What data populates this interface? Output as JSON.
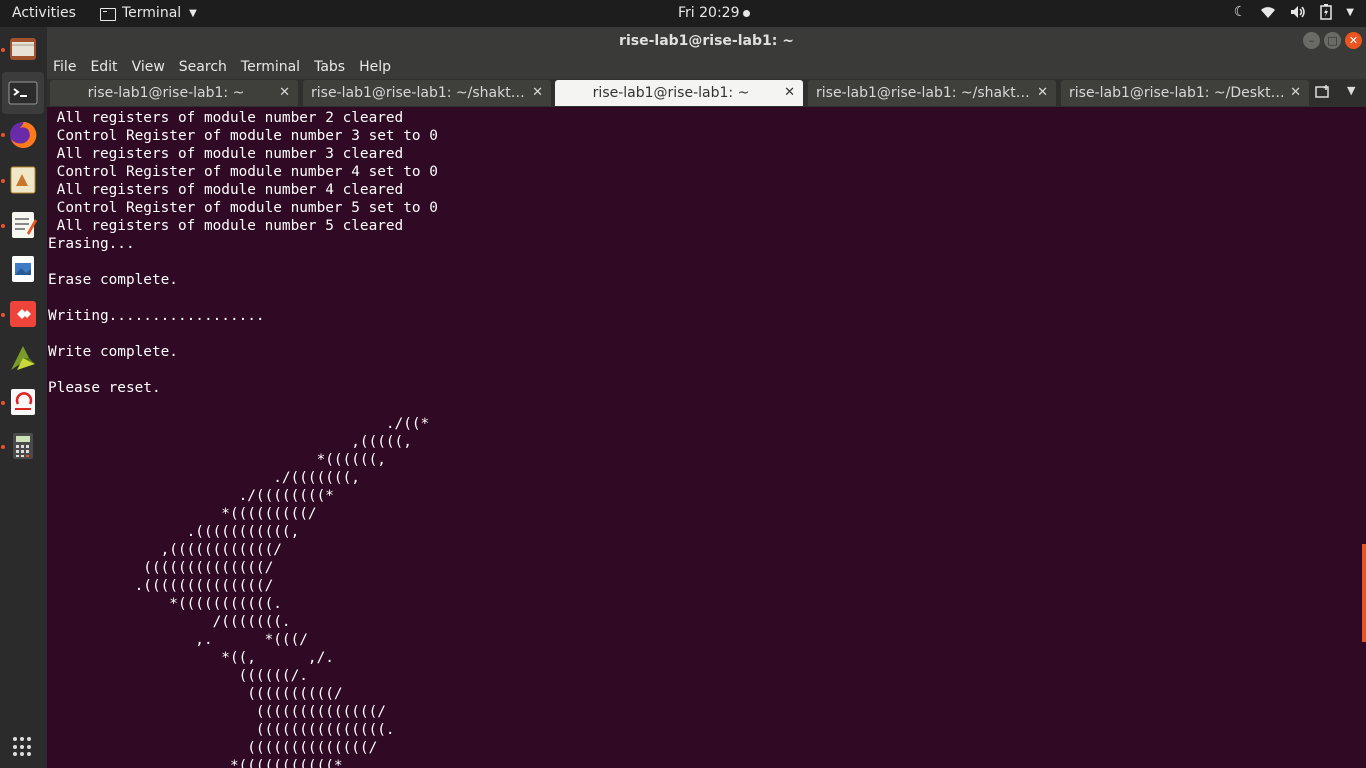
{
  "topbar": {
    "activities": "Activities",
    "app_name": "Terminal",
    "clock": "Fri 20:29",
    "tray_icons": [
      "moon-icon",
      "wifi-icon",
      "volume-icon",
      "battery-icon",
      "chevron-down-icon"
    ]
  },
  "dock": {
    "items": [
      "files-icon",
      "terminal-icon",
      "firefox-icon",
      "draw-icon",
      "text-editor-icon",
      "image-viewer-icon",
      "anydesk-icon",
      "vivado-icon",
      "eclipse-icon",
      "calculator-icon"
    ]
  },
  "window": {
    "title": "rise-lab1@rise-lab1: ~"
  },
  "menu": [
    "File",
    "Edit",
    "View",
    "Search",
    "Terminal",
    "Tabs",
    "Help"
  ],
  "tabs": [
    {
      "label": "rise-lab1@rise-lab1: ~"
    },
    {
      "label": "rise-lab1@rise-lab1: ~/shakti-..."
    },
    {
      "label": "rise-lab1@rise-lab1: ~"
    },
    {
      "label": "rise-lab1@rise-lab1: ~/shakti-..."
    },
    {
      "label": "rise-lab1@rise-lab1: ~/Deskto..."
    }
  ],
  "terminal": {
    "output": " All registers of module number 2 cleared\n Control Register of module number 3 set to 0\n All registers of module number 3 cleared\n Control Register of module number 4 set to 0\n All registers of module number 4 cleared\n Control Register of module number 5 set to 0\n All registers of module number 5 cleared\nErasing...\n\nErase complete.\n\nWriting..................\n\nWrite complete.\n\nPlease reset.\n\n                                       ./((*\n                                   ,(((((,\n                               *((((((,\n                          ./(((((((,\n                      ./((((((((*\n                    *(((((((((/\n                .(((((((((((,\n             ,((((((((((((/\n           ((((((((((((((/\n          .((((((((((((((/\n              *(((((((((((.\n                   /(((((((.\n                 ,.      *(((/\n                    *((,      ,/.\n                      ((((((/.\n                       ((((((((((/\n                        ((((((((((((((/\n                        (((((((((((((((.\n                       ((((((((((((((/\n                     *(((((((((((*"
  },
  "colors": {
    "terminal_bg": "#300a24",
    "accent": "#e95420",
    "topbar_bg": "#1d1d1d",
    "dock_bg": "#2b2b2b"
  }
}
